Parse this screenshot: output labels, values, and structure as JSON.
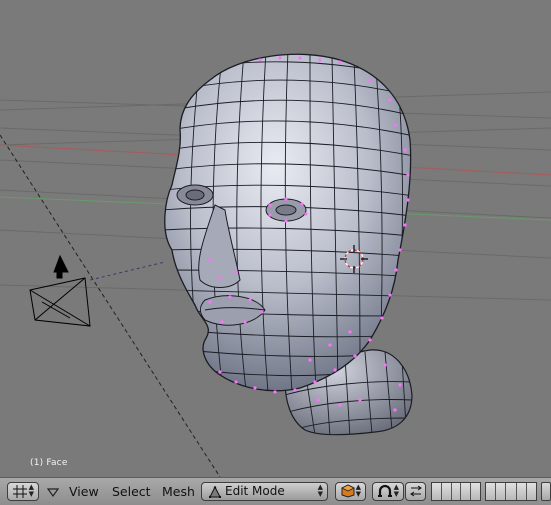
{
  "viewport": {
    "object_info": "(1) Face"
  },
  "header": {
    "editor_type_icon": "grid-icon",
    "menus": [
      "View",
      "Select",
      "Mesh"
    ],
    "mode_label": "Edit Mode",
    "mode_icon": "edit-mode-icon",
    "draw_type_icon": "solid-shading-icon",
    "pivot_icon": "pivot-icon",
    "manipulator_icon": "manipulator-icon"
  },
  "colors": {
    "viewport_bg": "#7a7a7a",
    "header_bg": "#9a9a9a",
    "mesh_wire": "#1b1d24",
    "vertex": "#ff70ff",
    "x_axis": "#b85a5a",
    "y_axis": "#6aa06a"
  }
}
